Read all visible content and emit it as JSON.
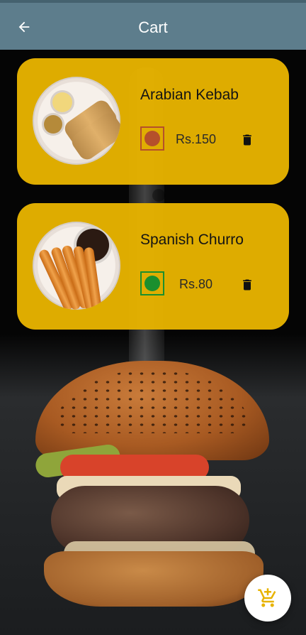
{
  "header": {
    "title": "Cart",
    "back_icon": "arrow-left-icon"
  },
  "cart": {
    "items": [
      {
        "name": "Arabian Kebab",
        "price": "Rs.150",
        "color": "#b5502b",
        "icon": "trash-icon"
      },
      {
        "name": "Spanish Churro",
        "price": "Rs.80",
        "color": "#1b8f2e",
        "icon": "trash-icon"
      }
    ]
  },
  "fab": {
    "icon": "add-to-cart-icon"
  },
  "colors": {
    "header_bg": "#5d7d8c",
    "card_bg": "#e7b300",
    "fab_bg": "#ffffff",
    "accent": "#e7b300"
  }
}
